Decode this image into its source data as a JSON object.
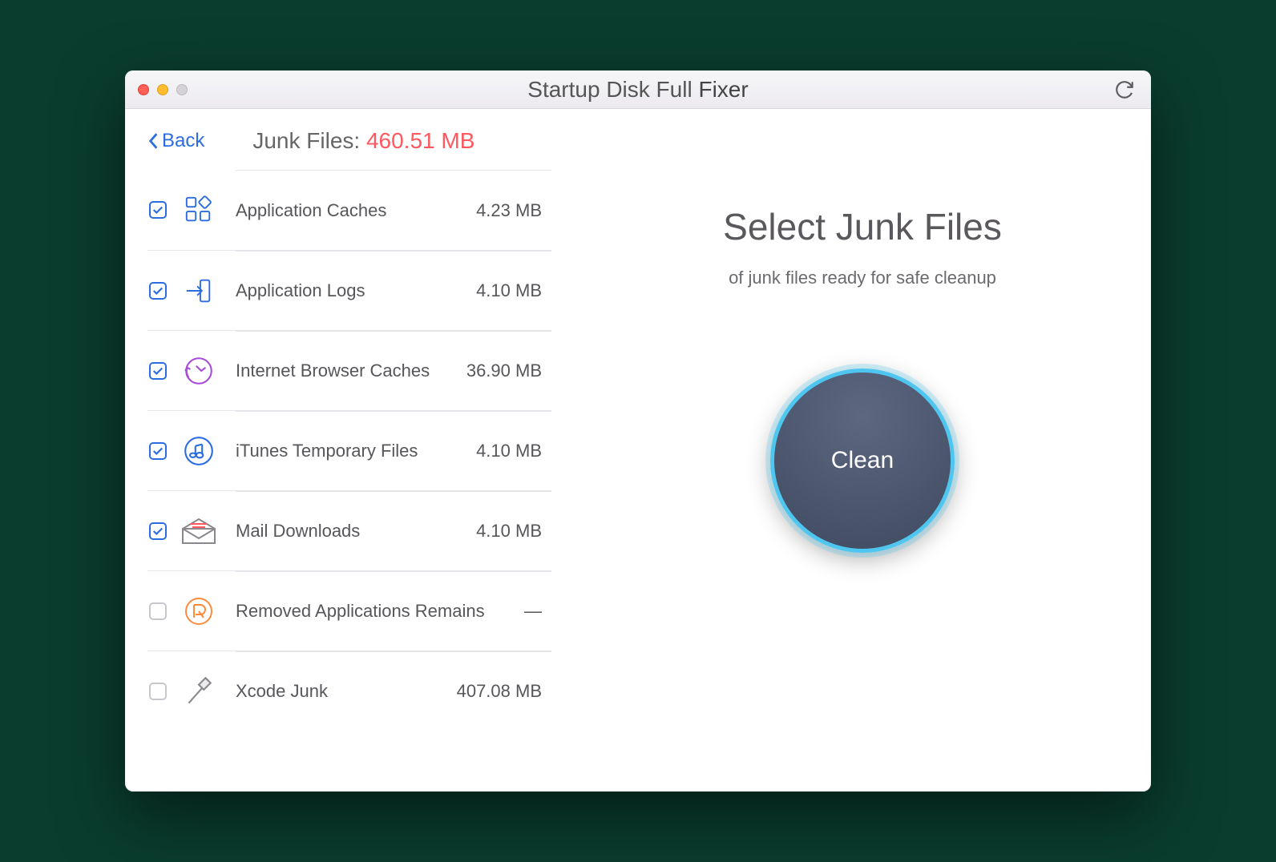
{
  "title_light": "Startup Disk Full",
  "title_bold": "Fixer",
  "back_label": "Back",
  "junk_label": "Junk Files:",
  "junk_total": "460.51 MB",
  "items": [
    {
      "label": "Application Caches",
      "size": "4.23 MB",
      "checked": true,
      "icon": "grid"
    },
    {
      "label": "Application Logs",
      "size": "4.10 MB",
      "checked": true,
      "icon": "arrow-in"
    },
    {
      "label": "Internet Browser Caches",
      "size": "36.90 MB",
      "checked": true,
      "icon": "browser-refresh"
    },
    {
      "label": "iTunes Temporary Files",
      "size": "4.10 MB",
      "checked": true,
      "icon": "music"
    },
    {
      "label": "Mail Downloads",
      "size": "4.10 MB",
      "checked": true,
      "icon": "mail"
    },
    {
      "label": "Removed Applications Remains",
      "size": "—",
      "checked": false,
      "icon": "removed"
    },
    {
      "label": "Xcode Junk",
      "size": "407.08 MB",
      "checked": false,
      "icon": "hammer"
    }
  ],
  "right": {
    "heading": "Select Junk Files",
    "subtitle": "of junk files ready for safe cleanup",
    "button": "Clean"
  }
}
